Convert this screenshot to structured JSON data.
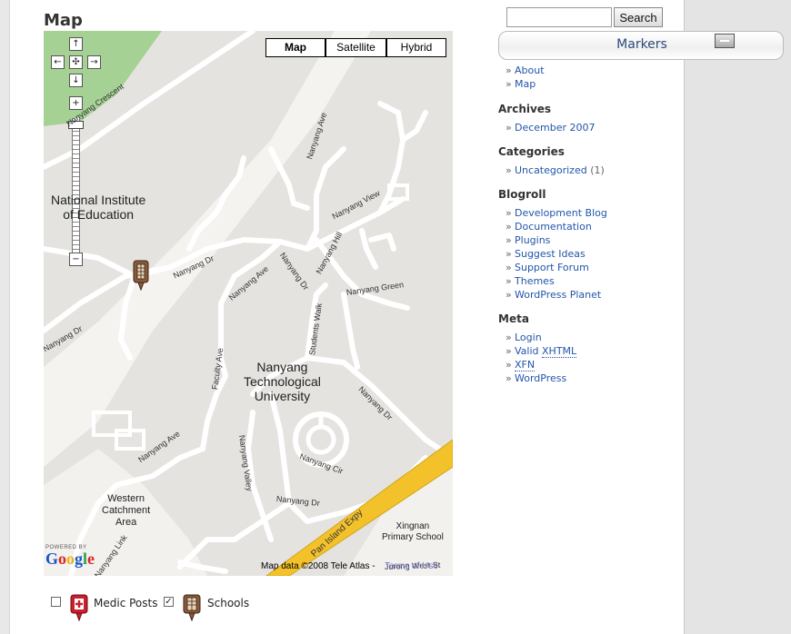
{
  "page": {
    "title": "Map"
  },
  "map": {
    "map_types": [
      {
        "label": "Map",
        "active": true
      },
      {
        "label": "Satellite",
        "active": false
      },
      {
        "label": "Hybrid",
        "active": false
      }
    ],
    "zoom_in_label": "+",
    "zoom_out_label": "−",
    "places": {
      "nie": "National Institute\nof Education",
      "ntu": "Nanyang\nTechnological\nUniversity",
      "western": "Western\nCatchment\nArea",
      "xingnan": "Xingnan\nPrimary School"
    },
    "streets": [
      "Nanyang Crescent",
      "Nanyang Ave",
      "Nanyang View",
      "Nanyang Dr",
      "Nanyang Ave",
      "Nanyang Dr",
      "Nanyang Hill",
      "Nanyang Green",
      "Students Walk",
      "Faculty Ave",
      "Nanyang Dr",
      "Nanyang Ave",
      "Nanyang Valley",
      "Nanyang Cir",
      "Nanyang Dr",
      "Pan Island Expy",
      "Nanyang Link",
      "Jurong West St"
    ],
    "powered_by": "POWERED BY",
    "google_logo": "Google",
    "copyright": "Map data ©2008 Tele Atlas -",
    "terms": "Terms of Use"
  },
  "legend": {
    "items": [
      {
        "label": "Medic Posts",
        "checked": false,
        "icon": "medic-post-marker-icon",
        "color": "#cc1f2d"
      },
      {
        "label": "Schools",
        "checked": true,
        "icon": "school-marker-icon",
        "color": "#8b5a3c"
      }
    ]
  },
  "sidebar": {
    "search": {
      "value": "",
      "button_label": "Search"
    },
    "markers_panel": {
      "title": "Markers"
    },
    "pages": [
      {
        "label": "About"
      },
      {
        "label": "Map"
      }
    ],
    "archives": {
      "heading": "Archives",
      "items": [
        {
          "label": "December 2007"
        }
      ]
    },
    "categories": {
      "heading": "Categories",
      "items": [
        {
          "label": "Uncategorized",
          "count": "(1)"
        }
      ]
    },
    "blogroll": {
      "heading": "Blogroll",
      "items": [
        {
          "label": "Development Blog"
        },
        {
          "label": "Documentation"
        },
        {
          "label": "Plugins"
        },
        {
          "label": "Suggest Ideas"
        },
        {
          "label": "Support Forum"
        },
        {
          "label": "Themes"
        },
        {
          "label": "WordPress Planet"
        }
      ]
    },
    "meta": {
      "heading": "Meta",
      "items": [
        {
          "label": "Login"
        },
        {
          "prefix": "Valid ",
          "abbr": "XHTML"
        },
        {
          "abbr": "XFN"
        },
        {
          "label": "WordPress"
        }
      ]
    }
  },
  "colors": {
    "land": "#e5e3df",
    "park": "#a6d194",
    "road": "#ffffff",
    "highway": "#f3c22b",
    "link": "#2255aa"
  }
}
